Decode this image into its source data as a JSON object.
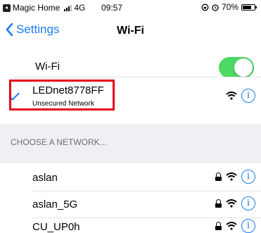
{
  "status_bar": {
    "app_name": "Magic Home",
    "network": "4G",
    "time": "09:57",
    "battery": "70%",
    "battery_level": 0.7
  },
  "nav": {
    "back_label": "Settings",
    "title": "Wi-Fi"
  },
  "wifi_toggle": {
    "label": "Wi-Fi",
    "on": true
  },
  "connected": {
    "name": "LEDnet8778FF",
    "subtitle": "Unsecured Network"
  },
  "section_header": "CHOOSE A NETWORK...",
  "networks": [
    {
      "name": "aslan",
      "locked": true
    },
    {
      "name": "aslan_5G",
      "locked": true
    },
    {
      "name": "CU_UP0h",
      "locked": true
    }
  ],
  "colors": {
    "accent": "#1a7cf5",
    "toggle_on": "#4cd964",
    "highlight": "#e3001b",
    "group_bg": "#efeff4"
  },
  "icons": {
    "info": "i"
  }
}
